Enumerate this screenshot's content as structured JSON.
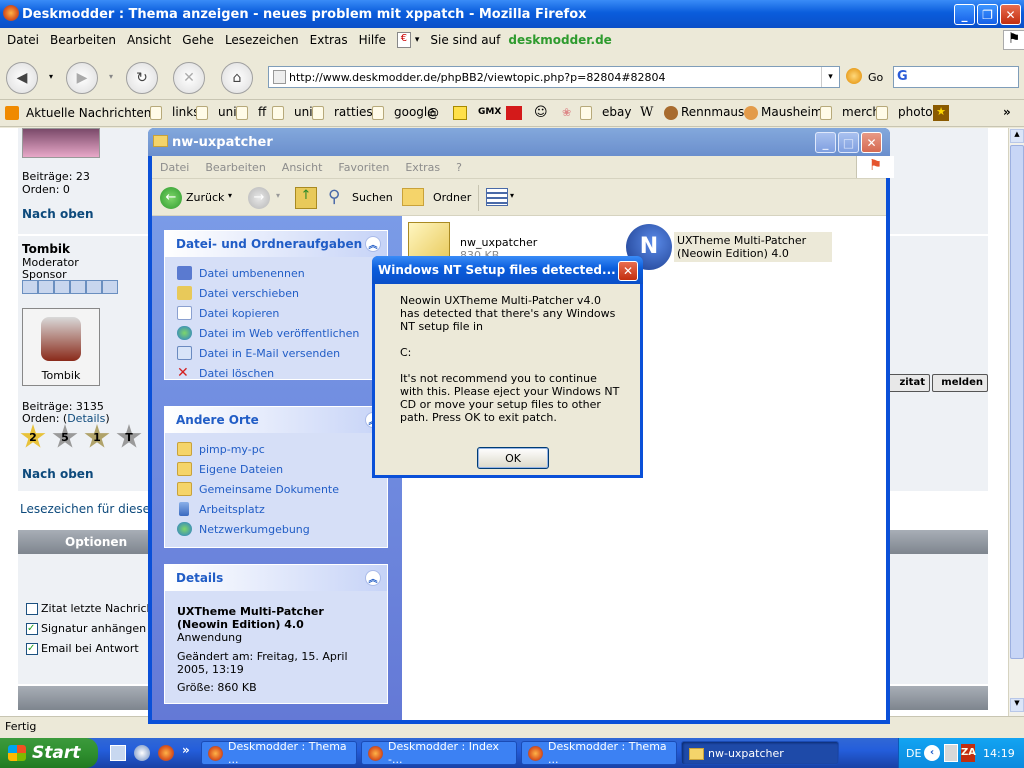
{
  "firefox": {
    "title": "Deskmodder : Thema anzeigen - neues problem mit xppatch - Mozilla Firefox",
    "menu": [
      "Datei",
      "Bearbeiten",
      "Ansicht",
      "Gehe",
      "Lesezeichen",
      "Extras",
      "Hilfe"
    ],
    "site_label": "Sie sind auf",
    "site_name": "deskmodder.de",
    "url": "http://www.deskmodder.de/phpBB2/viewtopic.php?p=82804#82804",
    "go_label": "Go",
    "bookmarks": [
      "Aktuelle Nachrichten...",
      "links",
      "uni",
      "ff",
      "uni",
      "ratties",
      "google",
      "ebay",
      "Rennmaus",
      "Mausheim",
      "merch",
      "photos"
    ],
    "status": "Fertig"
  },
  "forum": {
    "post1": {
      "posts": "Beiträge: 23",
      "origin": "Orden: 0"
    },
    "nav_top": "Nach oben",
    "user": {
      "name": "Tombik",
      "role1": "Moderator",
      "role2": "Sponsor",
      "avatar_label": "Tombik"
    },
    "post2": {
      "posts": "Beiträge: 3135",
      "origin_prefix": "Orden: (",
      "origin_link": "Details",
      "origin_suffix": ")"
    },
    "medals": [
      "2",
      "5",
      "1",
      "T"
    ],
    "nav_top2": "Nach oben",
    "bookmark_link": "Lesezeichen für diesen",
    "options_header": "Optionen",
    "zitat_btn": "zitat",
    "melden_btn": "melden",
    "checkboxes": [
      {
        "label": "Zitat letzte Nachricht",
        "checked": false
      },
      {
        "label": "Signatur anhängen",
        "checked": true
      },
      {
        "label": "Email bei Antwort",
        "checked": true
      }
    ]
  },
  "explorer": {
    "title": "nw-uxpatcher",
    "menu": [
      "Datei",
      "Bearbeiten",
      "Ansicht",
      "Favoriten",
      "Extras",
      "?"
    ],
    "toolbar": {
      "back": "Zurück",
      "search": "Suchen",
      "folders": "Ordner"
    },
    "tasks_title": "Datei- und Ordneraufgaben",
    "tasks": [
      "Datei umbenennen",
      "Datei verschieben",
      "Datei kopieren",
      "Datei im Web veröffentlichen",
      "Datei in E-Mail versenden",
      "Datei löschen"
    ],
    "places_title": "Andere Orte",
    "places": [
      "pimp-my-pc",
      "Eigene Dateien",
      "Gemeinsame Dokumente",
      "Arbeitsplatz",
      "Netzwerkumgebung"
    ],
    "details_title": "Details",
    "details": {
      "name": "UXTheme Multi-Patcher (Neowin Edition) 4.0",
      "type": "Anwendung",
      "modified": "Geändert am: Freitag, 15. April 2005, 13:19",
      "size": "Größe: 860 KB"
    },
    "files": [
      {
        "name": "nw_uxpatcher",
        "size": "830 KB"
      },
      {
        "name": "UXTheme Multi-Patcher (Neowin Edition) 4.0"
      }
    ]
  },
  "dialog": {
    "title": "Windows NT Setup files detected...",
    "line1": "Neowin UXTheme Multi-Patcher v4.0 has detected that there's any Windows NT setup file in",
    "line2": "C:",
    "line3": "It's not recommend you to continue with this. Please eject your Windows NT CD or move your setup files to other path. Press OK to exit patch.",
    "ok": "OK"
  },
  "taskbar": {
    "start": "Start",
    "items": [
      "Deskmodder : Thema ...",
      "Deskmodder : Index -...",
      "Deskmodder : Thema ...",
      "nw-uxpatcher"
    ],
    "lang": "DE",
    "time": "14:19"
  }
}
